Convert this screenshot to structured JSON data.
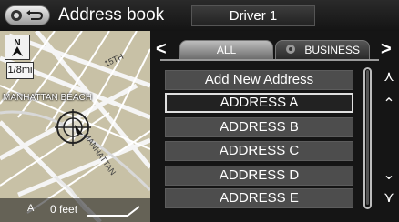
{
  "header": {
    "title": "Address book",
    "driver": "Driver 1"
  },
  "map": {
    "scale": "1/8mi",
    "city_label": "MANHATTAN BEACH",
    "street_15th": "15TH",
    "street_manhattan": "MANHATTAN",
    "footer_a": "A",
    "footer_feet": "0 feet"
  },
  "tabs": [
    {
      "label": "ALL",
      "active": true
    },
    {
      "label": "BUSINESS",
      "active": false
    }
  ],
  "list": {
    "items": [
      "Add New Address",
      "ADDRESS A",
      "ADDRESS B",
      "ADDRESS C",
      "ADDRESS D",
      "ADDRESS E"
    ],
    "selected_index": 1
  }
}
